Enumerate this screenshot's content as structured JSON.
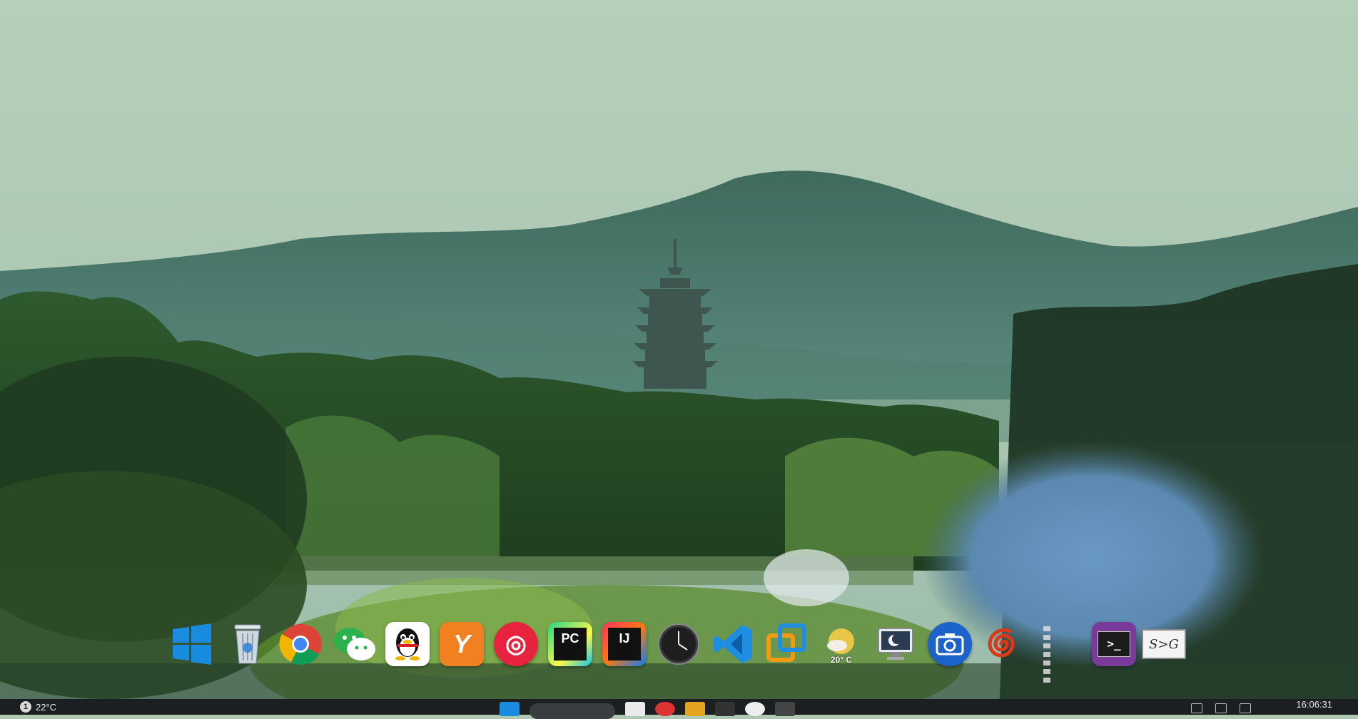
{
  "desktop": {
    "wallpaper_name": "West Lake landscape with Leifeng Pagoda"
  },
  "dock": {
    "items": [
      {
        "name": "windows-start",
        "icon": "windows-logo-icon",
        "bg": "#0a84d6",
        "glyph": ""
      },
      {
        "name": "recycle-bin",
        "icon": "recycle-bin-icon",
        "bg": "#c9d4dc",
        "glyph": ""
      },
      {
        "name": "chrome",
        "icon": "chrome-icon",
        "bg": "#e9ecef",
        "glyph": ""
      },
      {
        "name": "wechat",
        "icon": "wechat-icon",
        "bg": "#2bb24c",
        "glyph": ""
      },
      {
        "name": "qq",
        "icon": "qq-penguin-icon",
        "bg": "#ffffff",
        "glyph": ""
      },
      {
        "name": "app-y",
        "icon": "y-app-icon",
        "bg": "#f08020",
        "glyph": "Y"
      },
      {
        "name": "netease-music",
        "icon": "netease-music-icon",
        "bg": "#e8233f",
        "glyph": "◎"
      },
      {
        "name": "pycharm",
        "icon": "pycharm-icon",
        "bg": "#111111",
        "glyph": "PC"
      },
      {
        "name": "intellij",
        "icon": "intellij-icon",
        "bg": "#111111",
        "glyph": "IJ"
      },
      {
        "name": "clock",
        "icon": "clock-icon",
        "bg": "#2b2b2b",
        "glyph": ""
      },
      {
        "name": "vscode",
        "icon": "vscode-icon",
        "bg": "#1f8ee0",
        "glyph": "❮❯"
      },
      {
        "name": "virtualbox-style",
        "icon": "windows-overlap-icon",
        "bg": "#f29a12",
        "glyph": ""
      },
      {
        "name": "weather",
        "icon": "weather-sun-icon",
        "bg": "#e4c24a",
        "glyph": "",
        "label": "20° C"
      },
      {
        "name": "screensaver",
        "icon": "monitor-moon-icon",
        "bg": "#e0e6ea",
        "glyph": "☾"
      },
      {
        "name": "screenshot",
        "icon": "camera-icon",
        "bg": "#1b62c9",
        "glyph": "◉"
      },
      {
        "name": "spiral-app",
        "icon": "spiral-icon",
        "bg": "#d8391b",
        "glyph": "@"
      },
      {
        "name": "terminal",
        "icon": "terminal-icon",
        "bg": "#7a3a9a",
        "glyph": ">_"
      },
      {
        "name": "svg-tool",
        "icon": "monitor-text-icon",
        "bg": "#f4f4f4",
        "glyph": "S>G"
      }
    ]
  },
  "taskbar": {
    "weather_temp": "22°C",
    "weather_badge": "1",
    "clock_time": "16:06:31"
  }
}
